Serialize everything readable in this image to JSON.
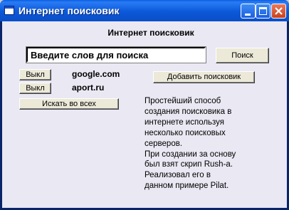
{
  "window": {
    "title": "Интернет поисковик"
  },
  "main": {
    "heading": "Интернет поисковик",
    "search_input_value": "Введите слов для поиска",
    "search_button_label": "Поиск",
    "engines": [
      {
        "toggle_label": "Выкл",
        "name": "google.com"
      },
      {
        "toggle_label": "Выкл",
        "name": "aport.ru"
      }
    ],
    "add_engine_label": "Добавить поисковик",
    "search_all_label": "Искать во всех",
    "description": "Простейший способ\nсоздания поисковика в\nинтернете используя\nнесколько поисковых\nсерверов.\nПри создании за основу\nбыл взят скрип Rush-a.\nРеализовал его в\nданном примере Pilat."
  },
  "icons": {
    "app": "window-app-icon",
    "minimize": "minimize-icon",
    "maximize": "maximize-icon",
    "close": "close-icon"
  },
  "colors": {
    "titlebar": "#0b58d8",
    "client_background": "#e9e8f3",
    "close_button": "#c8401e"
  }
}
